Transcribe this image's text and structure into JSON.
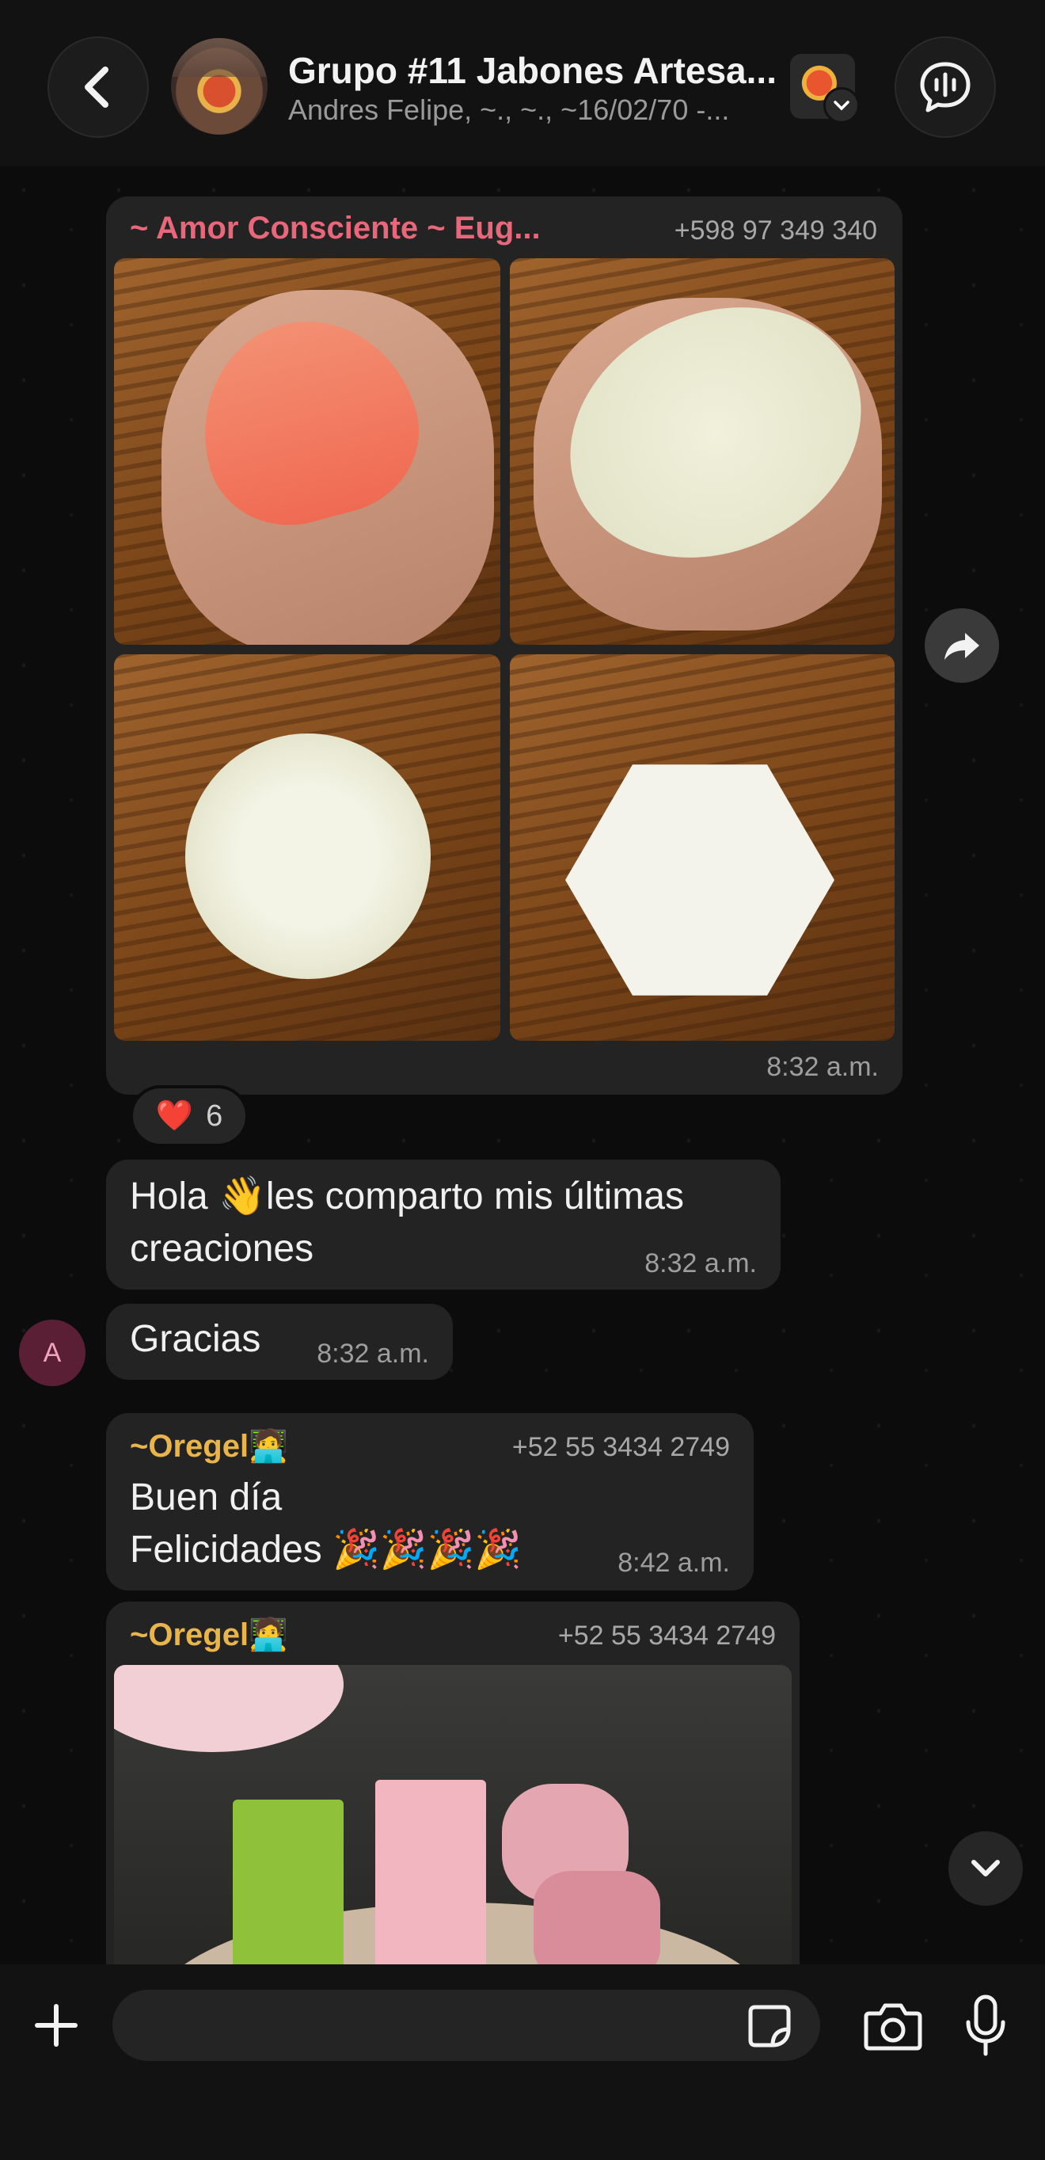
{
  "header": {
    "title": "Grupo #11 Jabones Artesa...",
    "subtitle": "Andres Felipe, ~., ~., ~16/02/70 -..."
  },
  "messages": {
    "album": {
      "sender": "~ Amor Consciente ~ Eug...",
      "phone": "+598 97 349 340",
      "time": "8:32 a.m.",
      "reaction_emoji": "❤️",
      "reaction_count": "6"
    },
    "msg1": {
      "text_line1": "Hola 👋les comparto mis últimas",
      "text_line2": "creaciones",
      "time": "8:32 a.m."
    },
    "msg2": {
      "avatar_letter": "A",
      "text": "Gracias",
      "time": "8:32 a.m."
    },
    "msg3": {
      "sender": "~Oregel🧑‍💻",
      "phone": "+52 55 3434 2749",
      "text_line1": "Buen día",
      "text_line2": "Felicidades 🎉🎉🎉🎉",
      "time": "8:42 a.m."
    },
    "msg4": {
      "sender": "~Oregel🧑‍💻",
      "phone": "+52 55 3434 2749"
    }
  },
  "colors": {
    "sender_pink": "#e8677a",
    "sender_yellow": "#e9b54a",
    "bubble_bg": "#232323"
  },
  "icons": {
    "back": "chevron-left-icon",
    "voice_chat": "waveform-icon",
    "forward": "forward-arrow-icon",
    "scroll_down": "chevron-down-icon",
    "add": "plus-icon",
    "sticker": "sticker-icon",
    "camera": "camera-icon",
    "mic": "microphone-icon"
  }
}
